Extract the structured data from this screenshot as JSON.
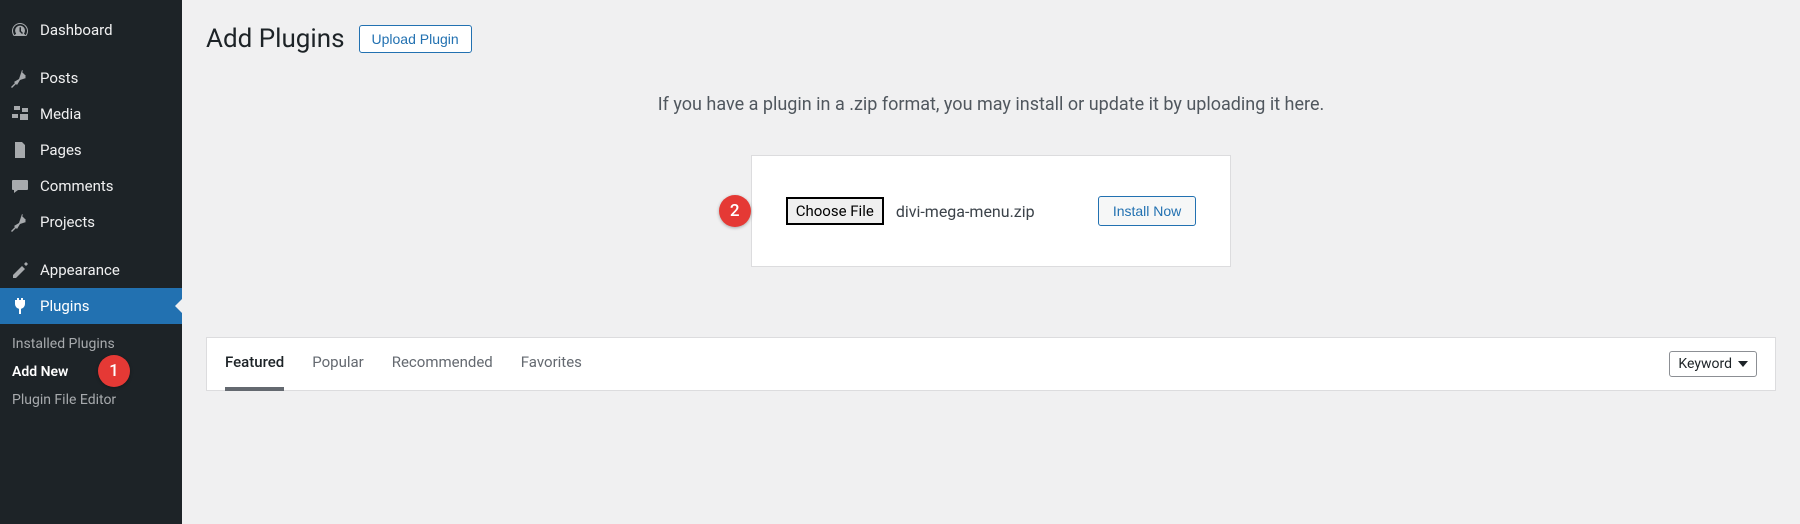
{
  "sidebar": {
    "items": [
      {
        "label": "Dashboard",
        "icon": "dashboard"
      },
      {
        "label": "Posts",
        "icon": "pin"
      },
      {
        "label": "Media",
        "icon": "media"
      },
      {
        "label": "Pages",
        "icon": "pages"
      },
      {
        "label": "Comments",
        "icon": "comments"
      },
      {
        "label": "Projects",
        "icon": "pin"
      },
      {
        "label": "Appearance",
        "icon": "appearance"
      },
      {
        "label": "Plugins",
        "icon": "plugins"
      }
    ],
    "submenu": [
      {
        "label": "Installed Plugins"
      },
      {
        "label": "Add New"
      },
      {
        "label": "Plugin File Editor"
      }
    ]
  },
  "header": {
    "title": "Add Plugins",
    "upload_button": "Upload Plugin"
  },
  "upload": {
    "instructions": "If you have a plugin in a .zip format, you may install or update it by uploading it here.",
    "choose_file_label": "Choose File",
    "file_name": "divi-mega-menu.zip",
    "install_button": "Install Now"
  },
  "markers": {
    "m1": "1",
    "m2": "2"
  },
  "tabs": [
    {
      "label": "Featured"
    },
    {
      "label": "Popular"
    },
    {
      "label": "Recommended"
    },
    {
      "label": "Favorites"
    }
  ],
  "filter": {
    "dropdown_value": "Keyword"
  }
}
